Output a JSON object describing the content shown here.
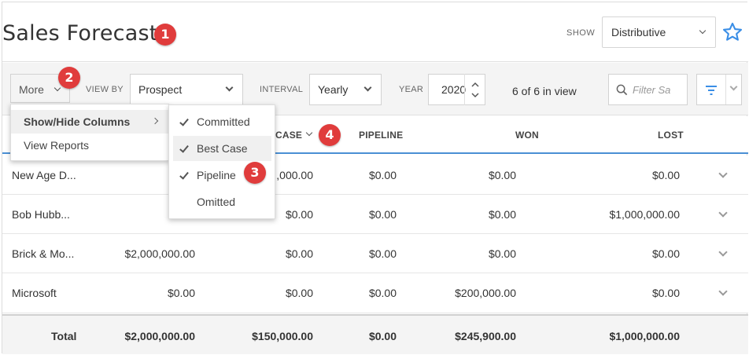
{
  "header": {
    "title": "Sales Forecast",
    "badge_1": "1",
    "show_label": "SHOW",
    "show_value": "Distributive"
  },
  "toolbar": {
    "more_label": "More",
    "badge_2": "2",
    "view_by_label": "VIEW BY",
    "view_by_value": "Prospect",
    "interval_label": "INTERVAL",
    "interval_value": "Yearly",
    "year_label": "YEAR",
    "year_value": "2020",
    "in_view_text": "6 of 6 in view",
    "filter_placeholder": "Filter Sa"
  },
  "more_menu": {
    "items": [
      {
        "label": "Show/Hide Columns"
      },
      {
        "label": "View Reports"
      }
    ]
  },
  "columns_menu": {
    "items": [
      {
        "label": "Committed",
        "checked": true
      },
      {
        "label": "Best Case",
        "checked": true
      },
      {
        "label": "Pipeline",
        "checked": true
      },
      {
        "label": "Omitted",
        "checked": false
      }
    ],
    "badge_3": "3"
  },
  "table": {
    "headers": {
      "best_case_partial": "CASE",
      "badge_4": "4",
      "pipeline": "PIPELINE",
      "won": "WON",
      "lost": "LOST"
    },
    "rows": [
      {
        "name": "New Age D...",
        "committed": "",
        "best_case": ",000.00",
        "pipeline": "$0.00",
        "won": "$0.00",
        "lost": "$0.00"
      },
      {
        "name": "Bob Hubb...",
        "committed": "",
        "best_case": "$0.00",
        "pipeline": "$0.00",
        "won": "$0.00",
        "lost": "$1,000,000.00"
      },
      {
        "name": "Brick & Mo...",
        "committed": "$2,000,000.00",
        "best_case": "$0.00",
        "pipeline": "$0.00",
        "won": "$0.00",
        "lost": "$0.00"
      },
      {
        "name": "Microsoft",
        "committed": "$0.00",
        "best_case": "$0.00",
        "pipeline": "$0.00",
        "won": "$200,000.00",
        "lost": "$0.00"
      }
    ],
    "total": {
      "label": "Total",
      "committed": "$2,000,000.00",
      "best_case": "$150,000.00",
      "pipeline": "$0.00",
      "won": "$245,900.00",
      "lost": "$1,000,000.00"
    }
  },
  "colors": {
    "accent_blue": "#4a8fd4",
    "badge_red": "#e03c3c"
  },
  "icons": [
    "chevron-down-icon",
    "star-icon",
    "search-icon",
    "filter-icon",
    "check-icon",
    "chevron-right-icon"
  ]
}
